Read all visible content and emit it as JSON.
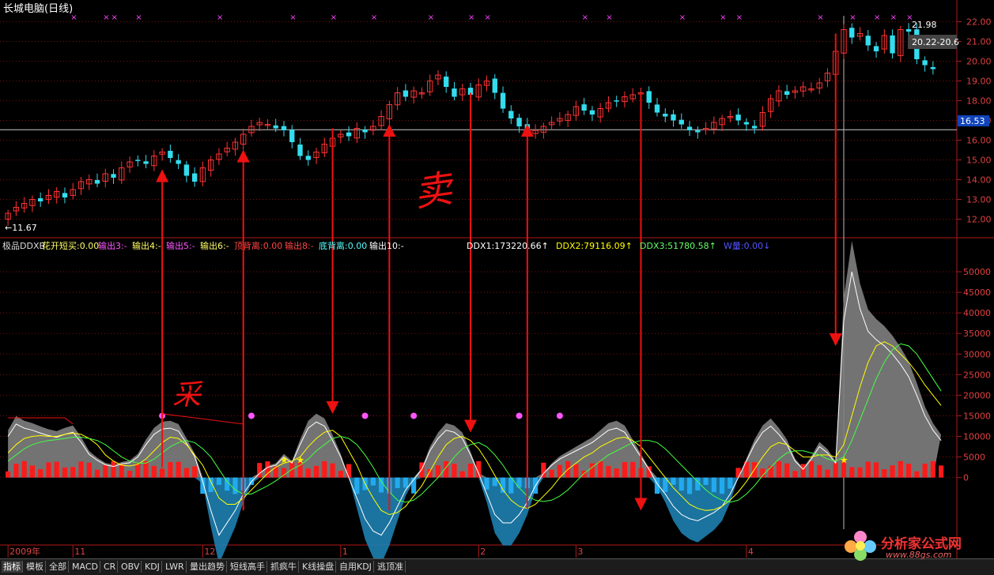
{
  "window": {
    "title": "长城电脑(日线)"
  },
  "price_panel": {
    "y_ticks": [
      "22.00",
      "21.00",
      "20.00",
      "19.00",
      "18.00",
      "17.00",
      "16.00",
      "15.00",
      "14.00",
      "13.00",
      "12.00"
    ],
    "current_price": "16.53",
    "low_label": "←11.67",
    "high_label": "21.98",
    "range_label": "20.22-20.6"
  },
  "indicator_panel": {
    "header_items": [
      {
        "text": "极品DDXB",
        "color": "#dddddd"
      },
      {
        "text": "花开短买:0.00",
        "color": "#ffff66"
      },
      {
        "text": "输出3:-",
        "color": "#ff55ff"
      },
      {
        "text": "输出4:-",
        "color": "#ffff66"
      },
      {
        "text": "输出5:-",
        "color": "#ff55ff"
      },
      {
        "text": "输出6:-",
        "color": "#ffff66"
      },
      {
        "text": "顶背离:0.00",
        "color": "#ff4444"
      },
      {
        "text": "输出8:-",
        "color": "#ff4444"
      },
      {
        "text": "底背离:0.00",
        "color": "#55ffff"
      },
      {
        "text": "输出10:-",
        "color": "#ffffff"
      },
      {
        "text": "DDX1:173220.66↑",
        "color": "#ffffff"
      },
      {
        "text": "DDX2:79116.09↑",
        "color": "#ffff00"
      },
      {
        "text": "DDX3:51780.58↑",
        "color": "#66ff66"
      },
      {
        "text": "W量:0.00↓",
        "color": "#5555ff"
      }
    ],
    "y_ticks": [
      "50000",
      "45000",
      "40000",
      "35000",
      "30000",
      "25000",
      "20000",
      "15000",
      "10000",
      "5000",
      "0"
    ]
  },
  "annotations": {
    "buy_mark": "采",
    "sell_mark": "卖"
  },
  "date_axis": [
    "2009年",
    "11",
    "12",
    "1",
    "2",
    "3",
    "4"
  ],
  "tabs": [
    "指标",
    "模板",
    "全部",
    "MACD",
    "CR",
    "OBV",
    "KDJ",
    "LWR",
    "量出趋势",
    "短线高手",
    "抓疯牛",
    "K线操盘",
    "自用KDJ",
    "逃顶准"
  ],
  "watermark": {
    "title": "分析家公式网",
    "url": "www.88gs.com"
  },
  "colors": {
    "up": "#ff3333",
    "down": "#33ddee",
    "grid": "#7a1010",
    "axis": "#b01818",
    "ddx1": "#ffffff",
    "ddx2": "#ffff00",
    "ddx3": "#44ff44",
    "arrow": "#ee1111"
  },
  "chart_data": [
    {
      "type": "candlestick",
      "title": "长城电脑(日线)",
      "ylim": [
        11.5,
        22.3
      ],
      "reference_line": 16.53,
      "closes": [
        12.3,
        12.6,
        12.8,
        13.0,
        12.9,
        13.2,
        13.4,
        13.1,
        13.5,
        13.9,
        14.0,
        13.8,
        14.3,
        14.1,
        14.6,
        14.9,
        15.0,
        14.8,
        15.2,
        15.4,
        15.1,
        14.8,
        14.2,
        13.9,
        14.6,
        15.0,
        15.3,
        15.6,
        15.9,
        16.3,
        16.7,
        16.9,
        16.8,
        16.6,
        16.5,
        15.9,
        15.2,
        15.0,
        15.4,
        15.8,
        16.1,
        16.3,
        16.2,
        16.6,
        16.4,
        16.7,
        17.2,
        17.8,
        18.4,
        18.2,
        18.5,
        18.4,
        19.0,
        19.3,
        18.7,
        18.2,
        18.6,
        18.3,
        18.8,
        19.0,
        18.4,
        17.6,
        17.1,
        16.7,
        16.4,
        16.5,
        16.7,
        16.9,
        17.1,
        17.3,
        17.7,
        17.5,
        17.3,
        17.6,
        17.9,
        18.0,
        18.2,
        18.3,
        18.4,
        17.9,
        17.4,
        17.2,
        17.0,
        16.8,
        16.5,
        16.4,
        16.6,
        16.9,
        17.1,
        17.2,
        17.0,
        16.8,
        16.6,
        17.4,
        18.1,
        18.5,
        18.3,
        18.5,
        18.7,
        18.6,
        18.9,
        19.4,
        20.5,
        21.6,
        21.2,
        21.4,
        20.8,
        20.5,
        21.3,
        20.4,
        21.6,
        21.5,
        20.1,
        19.8,
        19.6
      ]
    },
    {
      "type": "mixed",
      "title": "极品DDXB",
      "ylim": [
        -16000,
        55000
      ],
      "series": [
        {
          "name": "DDX1",
          "values": [
            10000,
            13000,
            12000,
            11500,
            10800,
            10200,
            9800,
            10500,
            11000,
            8600,
            5600,
            4200,
            3100,
            2700,
            3300,
            3600,
            5000,
            8000,
            10500,
            11800,
            12000,
            11300,
            8300,
            5100,
            -1000,
            -8000,
            -14000,
            -11000,
            -8000,
            -4000,
            -1000,
            1000,
            2500,
            3000,
            5000,
            3500,
            8000,
            12000,
            13500,
            12500,
            9000,
            5000,
            0,
            -5000,
            -10000,
            -13000,
            -14000,
            -11000,
            -7000,
            -3000,
            -500,
            2000,
            6500,
            9500,
            11500,
            11000,
            9500,
            5500,
            1000,
            -4000,
            -9000,
            -11000,
            -11000,
            -9000,
            -6000,
            -2000,
            1000,
            3000,
            4500,
            5500,
            6500,
            7500,
            8500,
            10000,
            11500,
            12000,
            11000,
            8000,
            5000,
            2000,
            -1500,
            -4000,
            -7000,
            -9000,
            -10000,
            -10500,
            -9500,
            -8500,
            -7000,
            -4000,
            0,
            4000,
            8000,
            11000,
            12500,
            10500,
            8000,
            4000,
            2000,
            4500,
            7500,
            6000,
            3500,
            38000,
            50000,
            41000,
            35500,
            33500,
            32000,
            30000,
            27500,
            24500,
            20000,
            15000,
            11500,
            9000
          ]
        },
        {
          "name": "DDX2",
          "values": [
            6000,
            8000,
            9500,
            10000,
            10200,
            10000,
            10000,
            10500,
            10800,
            10500,
            9500,
            8000,
            5500,
            4000,
            3000,
            2800,
            3200,
            4500,
            6500,
            8500,
            9800,
            9500,
            8000,
            5500,
            3000,
            -1000,
            -5000,
            -6500,
            -6500,
            -5000,
            -3000,
            -1000,
            1000,
            2500,
            3500,
            4000,
            5000,
            7500,
            9500,
            11000,
            11500,
            10000,
            6500,
            3000,
            -1500,
            -5000,
            -8000,
            -9000,
            -8500,
            -7000,
            -4500,
            -2000,
            1500,
            5000,
            8000,
            9500,
            10000,
            9000,
            7000,
            4000,
            500,
            -3000,
            -5500,
            -7000,
            -7500,
            -6500,
            -4500,
            -2500,
            0,
            2000,
            3500,
            5000,
            6000,
            7500,
            8500,
            9500,
            9800,
            9000,
            7500,
            5000,
            2500,
            0,
            -2500,
            -4500,
            -6500,
            -7500,
            -8000,
            -7800,
            -7000,
            -5500,
            -3500,
            -1000,
            2000,
            5000,
            7500,
            8500,
            8000,
            6500,
            5000,
            5000,
            5500,
            5500,
            5000,
            8000,
            15000,
            22000,
            28000,
            32000,
            33000,
            32000,
            30000,
            28000,
            25500,
            22500,
            20000,
            17500
          ]
        },
        {
          "name": "DDX3",
          "values": [
            4000,
            5500,
            7000,
            8000,
            8600,
            9000,
            9200,
            9500,
            9800,
            9800,
            9500,
            9000,
            8000,
            6500,
            5000,
            4000,
            3500,
            3500,
            4500,
            6000,
            7500,
            8500,
            9000,
            8500,
            7000,
            5000,
            2000,
            -1000,
            -3000,
            -4000,
            -4000,
            -3000,
            -2000,
            -800,
            600,
            2000,
            3000,
            4500,
            6500,
            8000,
            9500,
            10000,
            9500,
            8000,
            5500,
            2500,
            -1000,
            -3500,
            -5500,
            -6000,
            -5500,
            -4000,
            -2000,
            0,
            2500,
            5000,
            7000,
            8000,
            8500,
            7500,
            5500,
            3000,
            0,
            -2500,
            -4500,
            -5500,
            -5800,
            -5500,
            -4500,
            -3000,
            -1000,
            1000,
            2500,
            4000,
            5500,
            6500,
            7500,
            8500,
            9000,
            9000,
            8500,
            7000,
            5000,
            3000,
            1000,
            -1000,
            -3000,
            -4500,
            -5500,
            -6000,
            -5500,
            -4000,
            -2000,
            500,
            2500,
            4500,
            6000,
            6500,
            6500,
            6000,
            5500,
            4500,
            4000,
            5000,
            9000,
            14000,
            19000,
            24000,
            28000,
            31000,
            32500,
            32000,
            30000,
            27000,
            24000,
            21000
          ]
        }
      ]
    }
  ]
}
